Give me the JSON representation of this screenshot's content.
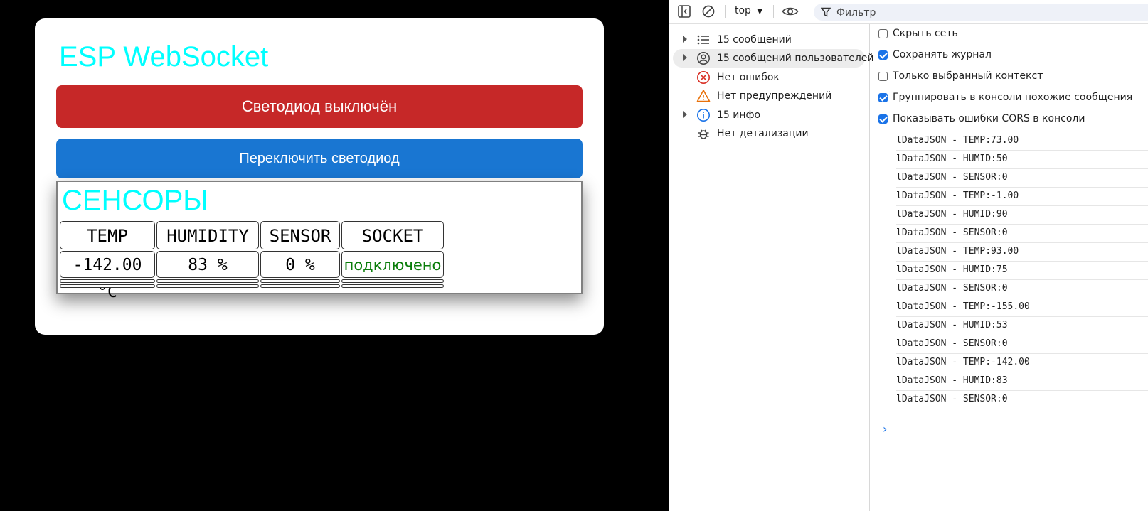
{
  "esp_page": {
    "title": "ESP WebSocket",
    "led_status": "Светодиод выключён",
    "toggle_button": "Переключить светодиод",
    "sensors_title": "СЕНСОРЫ",
    "headers": [
      "TEMP",
      "HUMIDITY",
      "SENSOR",
      "SOCKET"
    ],
    "values": {
      "temp": "-142.00 °C",
      "humidity": "83 %",
      "sensor": "0 %",
      "socket": "подключено"
    },
    "colors": {
      "title": "#00ffff",
      "led_off": "#c62828",
      "toggle": "#1976d2",
      "connected": "#0a7d0a"
    }
  },
  "devtools": {
    "toolbar": {
      "sidebar_toggle_icon": "sidebar-icon",
      "clear_icon": "clear-console-icon",
      "context": "top",
      "eye_icon": "live-expression-icon",
      "filter_placeholder": "Фильтр"
    },
    "sidebar": [
      {
        "label": "15 сообщений",
        "icon": "list-icon"
      },
      {
        "label": "15 сообщений пользователей",
        "icon": "user-icon"
      },
      {
        "label": "Нет ошибок",
        "icon": "error-icon"
      },
      {
        "label": "Нет предупреждений",
        "icon": "warning-icon"
      },
      {
        "label": "15 инфо",
        "icon": "info-icon"
      },
      {
        "label": "Нет детализации",
        "icon": "bug-icon"
      }
    ],
    "settings": [
      {
        "label": "Скрыть сеть",
        "checked": false
      },
      {
        "label": "Сохранять журнал",
        "checked": true
      },
      {
        "label": "Только выбранный контекст",
        "checked": false
      },
      {
        "label": "Группировать в консоли похожие сообщения",
        "checked": true
      },
      {
        "label": "Показывать ошибки CORS в консоли",
        "checked": true
      }
    ],
    "logs": [
      "lDataJSON - TEMP:73.00",
      "lDataJSON - HUMID:50",
      "lDataJSON - SENSOR:0",
      "lDataJSON - TEMP:-1.00",
      "lDataJSON - HUMID:90",
      "lDataJSON - SENSOR:0",
      "lDataJSON - TEMP:93.00",
      "lDataJSON - HUMID:75",
      "lDataJSON - SENSOR:0",
      "lDataJSON - TEMP:-155.00",
      "lDataJSON - HUMID:53",
      "lDataJSON - SENSOR:0",
      "lDataJSON - TEMP:-142.00",
      "lDataJSON - HUMID:83",
      "lDataJSON - SENSOR:0"
    ],
    "prompt": "›"
  }
}
